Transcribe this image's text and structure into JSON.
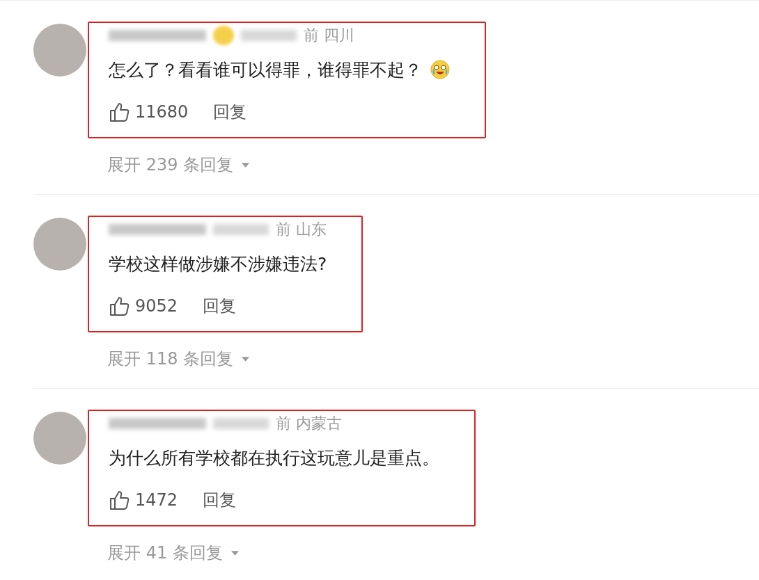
{
  "comments": [
    {
      "meta": "前 四川",
      "badge": true,
      "text": "怎么了？看看谁可以得罪，谁得罪不起？",
      "emoji": true,
      "likes": "11680",
      "reply": "回复",
      "expand": "展开 239 条回复"
    },
    {
      "meta": "前 山东",
      "badge": false,
      "text": "学校这样做涉嫌不涉嫌违法?",
      "emoji": false,
      "likes": "9052",
      "reply": "回复",
      "expand": "展开 118 条回复"
    },
    {
      "meta": "前 内蒙古",
      "badge": false,
      "text": "为什么所有学校都在执行这玩意儿是重点。",
      "emoji": false,
      "likes": "1472",
      "reply": "回复",
      "expand": "展开 41 条回复"
    }
  ]
}
